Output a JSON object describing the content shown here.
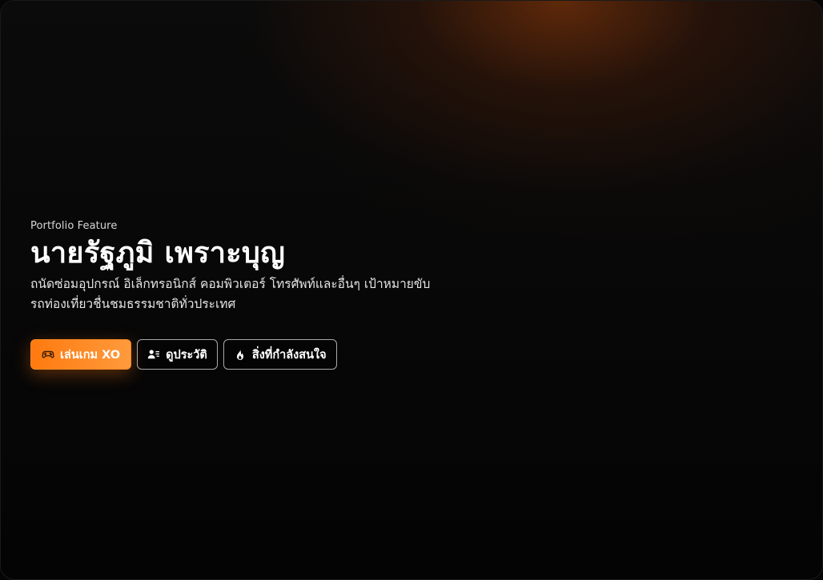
{
  "hero": {
    "eyebrow": "Portfolio Feature",
    "name": "นายรัฐภูมิ เพราะบุญ",
    "description": "ถนัดซ่อมอุปกรณ์ อิเล็กทรอนิกส์ คอมพิวเตอร์ โทรศัพท์และอื่นๆ เป้าหมายขับรถท่องเที่ยวชื่นชมธรรมชาติทั่วประเทศ"
  },
  "actions": [
    {
      "label": "เล่นเกม XO",
      "icon": "gamepad-icon",
      "style": "primary"
    },
    {
      "label": "ดูประวัติ",
      "icon": "profile-list-icon",
      "style": "outline"
    },
    {
      "label": "สิ่งที่กำลังสนใจ",
      "icon": "fire-icon",
      "style": "outline"
    }
  ],
  "colors": {
    "accent": "#ff7a0f",
    "accent_light": "#ff9a3c",
    "background": "#050505",
    "glow": "#5a2608",
    "text": "#ffffff"
  }
}
